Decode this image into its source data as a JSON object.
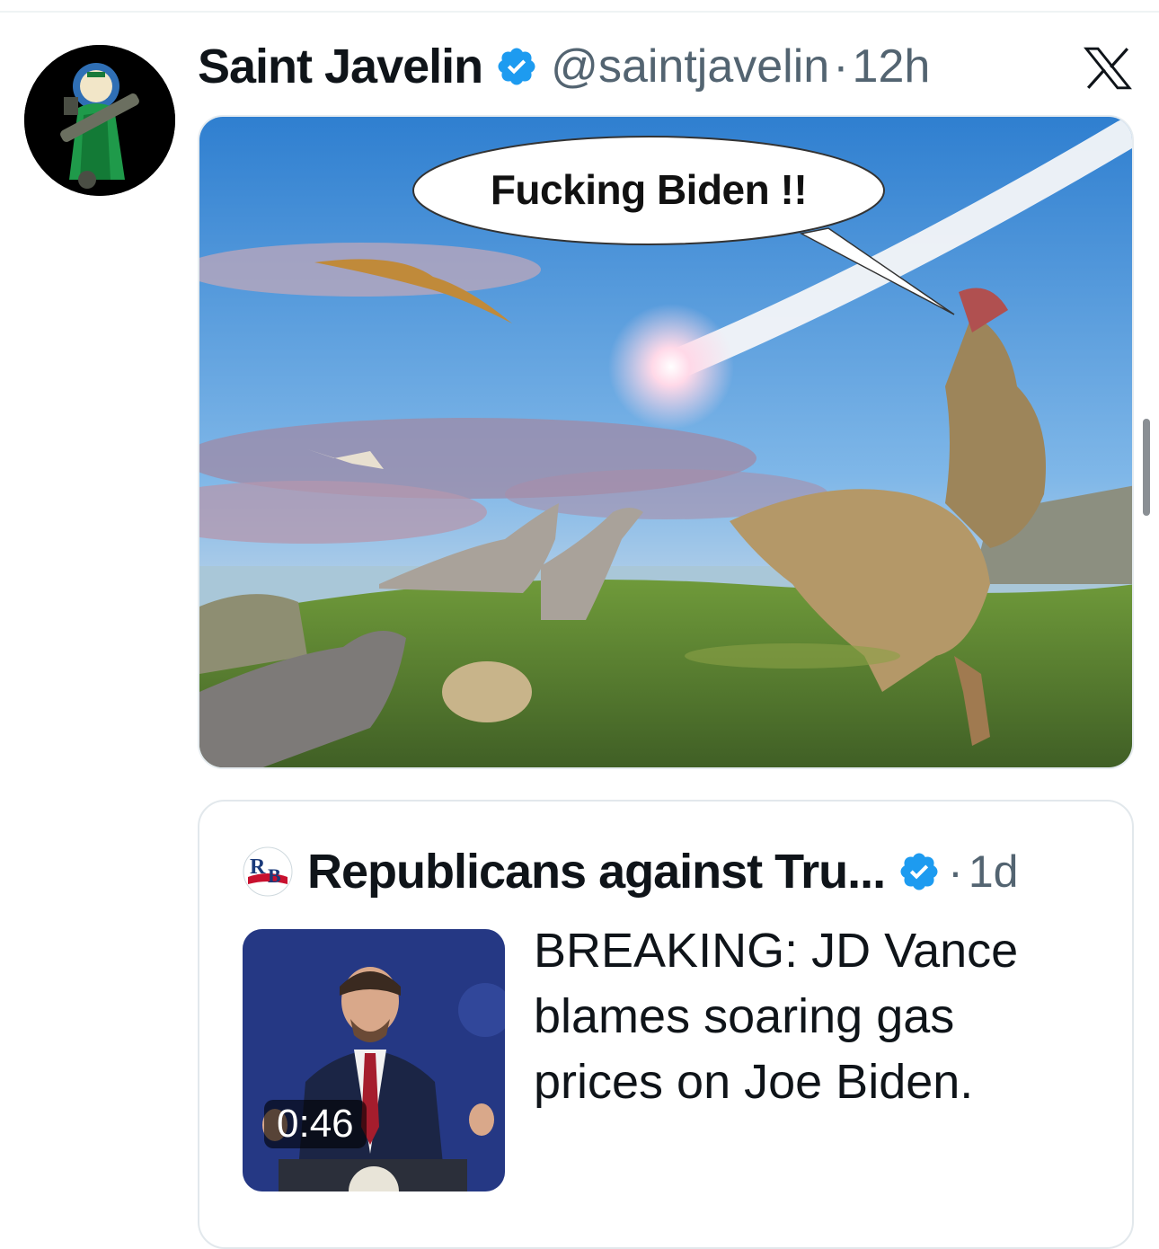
{
  "tweet": {
    "display_name": "Saint Javelin",
    "handle": "@saintjavelin",
    "separator": "·",
    "time": "12h",
    "media": {
      "speech_bubble": "Fucking Biden !!"
    }
  },
  "quote": {
    "display_name": "Republicans against Tru...",
    "separator": "·",
    "time": "1d",
    "logo_text": "RB",
    "video_duration": "0:46",
    "text": "BREAKING: JD Vance blames soaring gas prices on Joe Biden."
  },
  "icons": {
    "verified": "verified-badge-icon",
    "x_logo": "x-logo-icon"
  },
  "colors": {
    "verified_blue": "#1d9bf0",
    "secondary_text": "#536471"
  }
}
